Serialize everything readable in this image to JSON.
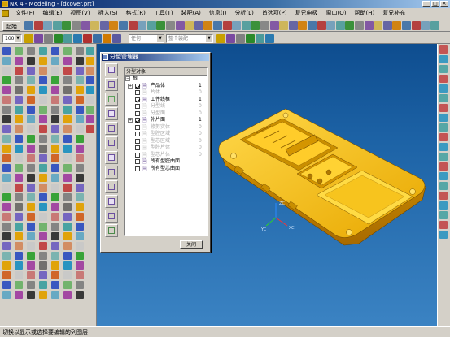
{
  "window": {
    "title": "NX 4 - Modeling - [dcover.prt]",
    "controls": [
      "_",
      "□",
      "×"
    ]
  },
  "menu": [
    "文件(F)",
    "编辑(E)",
    "视图(V)",
    "插入(S)",
    "格式(R)",
    "工具(T)",
    "装配(A)",
    "信息(I)",
    "分析(L)",
    "首选项(P)",
    "复兄电极",
    "窗口(O)",
    "帮助(H)",
    "复兄补充"
  ],
  "toolbar": {
    "start_label": "起始",
    "zoom_value": "100",
    "filter_combo": "任何",
    "assembly_combo": "整个装配"
  },
  "dialog": {
    "title": "分型管理器",
    "tree_header": "分型对象",
    "close_label": "关闭",
    "tree": [
      {
        "label": "根",
        "num": "",
        "level": 0,
        "toggle": "−",
        "checkbox": false,
        "checked": false,
        "dim": false
      },
      {
        "label": "产品体",
        "num": "1",
        "level": 1,
        "toggle": "+",
        "checkbox": true,
        "checked": true,
        "dim": false
      },
      {
        "label": "片体",
        "num": "0",
        "level": 1,
        "toggle": "",
        "checkbox": true,
        "checked": false,
        "dim": true
      },
      {
        "label": "工件线框",
        "num": "1",
        "level": 1,
        "toggle": "",
        "checkbox": true,
        "checked": true,
        "dim": false
      },
      {
        "label": "分型线",
        "num": "0",
        "level": 1,
        "toggle": "",
        "checkbox": true,
        "checked": false,
        "dim": true
      },
      {
        "label": "分型面",
        "num": "0",
        "level": 1,
        "toggle": "",
        "checkbox": true,
        "checked": false,
        "dim": true
      },
      {
        "label": "补片面",
        "num": "1",
        "level": 1,
        "toggle": "+",
        "checkbox": true,
        "checked": true,
        "dim": false
      },
      {
        "label": "修剪实体",
        "num": "0",
        "level": 1,
        "toggle": "",
        "checkbox": true,
        "checked": false,
        "dim": true
      },
      {
        "label": "型腔区域",
        "num": "0",
        "level": 1,
        "toggle": "",
        "checkbox": true,
        "checked": false,
        "dim": true
      },
      {
        "label": "型芯区域",
        "num": "0",
        "level": 1,
        "toggle": "",
        "checkbox": true,
        "checked": false,
        "dim": true
      },
      {
        "label": "型腔片体",
        "num": "0",
        "level": 1,
        "toggle": "",
        "checkbox": true,
        "checked": false,
        "dim": true
      },
      {
        "label": "型芯片体",
        "num": "0",
        "level": 1,
        "toggle": "",
        "checkbox": true,
        "checked": false,
        "dim": true
      },
      {
        "label": "所有型腔曲面",
        "num": "",
        "level": 1,
        "toggle": "",
        "checkbox": true,
        "checked": false,
        "dim": false
      },
      {
        "label": "所有型芯曲面",
        "num": "",
        "level": 1,
        "toggle": "",
        "checkbox": true,
        "checked": false,
        "dim": false
      }
    ]
  },
  "viewport": {
    "background_top": "#0e4d8f",
    "background_bottom": "#3b83c3",
    "part_color": "#f2b400",
    "axes": {
      "x": "XC",
      "y": "YC",
      "z": "ZC"
    }
  },
  "status_text": "切换以显示或选择要编辑的列图层"
}
